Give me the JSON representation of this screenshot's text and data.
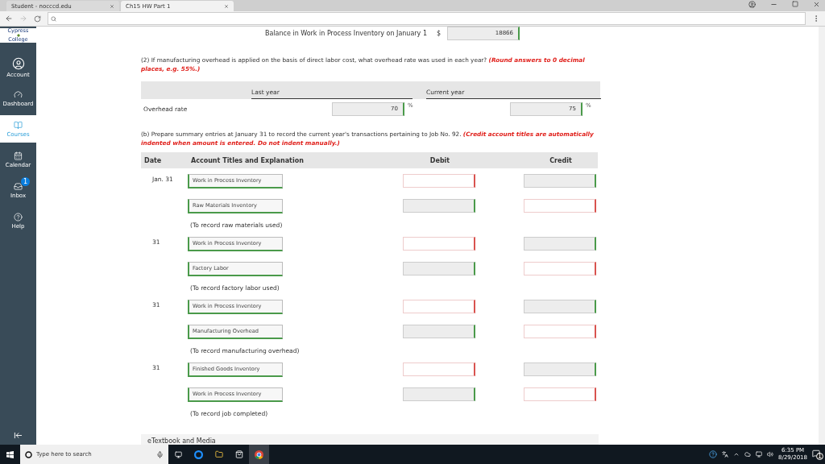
{
  "browser": {
    "tabs": [
      {
        "title": "Student - nocccd.edu",
        "selected": false
      },
      {
        "title": "Ch15 HW Part 1",
        "selected": true
      }
    ]
  },
  "sidebar": {
    "logo": [
      "Cypress",
      "College"
    ],
    "items": [
      {
        "label": "Account",
        "kind": "account",
        "selected": false
      },
      {
        "label": "Dashboard",
        "kind": "dashboard",
        "selected": false
      },
      {
        "label": "Courses",
        "kind": "courses",
        "selected": true
      },
      {
        "label": "Calendar",
        "kind": "calendar",
        "selected": false
      },
      {
        "label": "Inbox",
        "kind": "inbox",
        "selected": false,
        "badge": "1"
      },
      {
        "label": "Help",
        "kind": "help",
        "selected": false
      }
    ]
  },
  "balance": {
    "label": "Balance in Work in Process Inventory on January 1",
    "currency": "$",
    "value": "18866"
  },
  "question_2": {
    "text": "(2) If manufacturing overhead is applied on the basis of direct labor cost, what overhead rate was used in each year?",
    "hint": "(Round answers to 0 decimal places, e.g. 55%.)"
  },
  "overhead_table": {
    "columns": [
      "Last year",
      "Current year"
    ],
    "row_label": "Overhead rate",
    "values": [
      "70",
      "75"
    ],
    "unit": "%"
  },
  "question_b": {
    "text": "(b) Prepare summary entries at January 31 to record the current year's transactions pertaining to Job No. 92.",
    "hint": "(Credit account titles are automatically indented when amount is entered. Do not indent manually.)"
  },
  "journal": {
    "columns": [
      "Date",
      "Account Titles and Explanation",
      "Debit",
      "Credit"
    ],
    "entries": [
      {
        "date": "Jan. 31",
        "lines": [
          {
            "account": "Work in Process Inventory",
            "debit": {
              "disabled": false,
              "correct": false
            },
            "credit": {
              "disabled": true,
              "correct": true
            }
          },
          {
            "account": "Raw Materials Inventory",
            "debit": {
              "disabled": true,
              "correct": true
            },
            "credit": {
              "disabled": false,
              "correct": false
            }
          }
        ],
        "note": "(To record raw materials used)"
      },
      {
        "date": "31",
        "lines": [
          {
            "account": "Work in Process Inventory",
            "debit": {
              "disabled": false,
              "correct": false
            },
            "credit": {
              "disabled": true,
              "correct": true
            }
          },
          {
            "account": "Factory Labor",
            "debit": {
              "disabled": true,
              "correct": true
            },
            "credit": {
              "disabled": false,
              "correct": false
            }
          }
        ],
        "note": "(To record factory labor used)"
      },
      {
        "date": "31",
        "lines": [
          {
            "account": "Work in Process Inventory",
            "debit": {
              "disabled": false,
              "correct": false
            },
            "credit": {
              "disabled": true,
              "correct": true
            }
          },
          {
            "account": "Manufacturing Overhead",
            "debit": {
              "disabled": true,
              "correct": true
            },
            "credit": {
              "disabled": false,
              "correct": false
            }
          }
        ],
        "note": "(To record manufacturing overhead)"
      },
      {
        "date": "31",
        "lines": [
          {
            "account": "Finished Goods Inventory",
            "debit": {
              "disabled": false,
              "correct": false
            },
            "credit": {
              "disabled": true,
              "correct": true
            }
          },
          {
            "account": "Work in Process Inventory",
            "debit": {
              "disabled": true,
              "correct": true
            },
            "credit": {
              "disabled": false,
              "correct": false
            }
          }
        ],
        "note": "(To record job completed)"
      }
    ]
  },
  "etextbook": {
    "label": "eTextbook and Media"
  },
  "taskbar": {
    "search_placeholder": "Type here to search",
    "time": "6:35 PM",
    "date": "8/29/2018",
    "notifications": "1"
  }
}
